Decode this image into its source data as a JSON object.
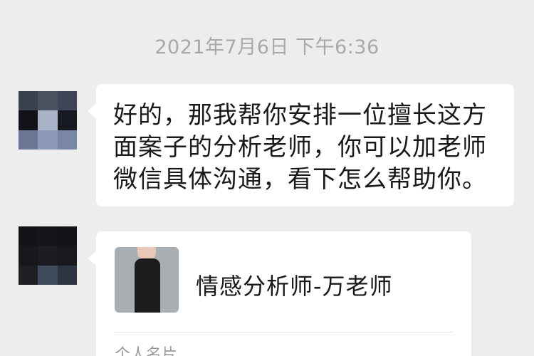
{
  "chat": {
    "timestamp": "2021年7月6日 下午6:36",
    "messages": [
      {
        "type": "text",
        "lines": [
          "好的，那我帮你安排一位擅长这方",
          "面案子的分析老师，你可以加老师",
          "微信具体沟通，看下怎么帮助你。"
        ]
      },
      {
        "type": "contact_card",
        "name": "情感分析师-万老师",
        "footer": "个人名片"
      }
    ]
  },
  "colors": {
    "background": "#ededed",
    "bubble": "#ffffff",
    "timestamp_text": "#a8a8a8",
    "message_text": "#191919"
  },
  "avatars": {
    "sender_1_pixels": [
      "#3a4150",
      "#4a5262",
      "#3e4557",
      "#111318",
      "#a9b2c6",
      "#16191f",
      "#6a7694",
      "#8a97b6",
      "#7a86a6"
    ],
    "sender_2_pixels": [
      "#121316",
      "#15161a",
      "#131418",
      "#17181c",
      "#1c1d21",
      "#18191d",
      "#1e1f23",
      "#3f4a5c",
      "#2d3542"
    ]
  }
}
